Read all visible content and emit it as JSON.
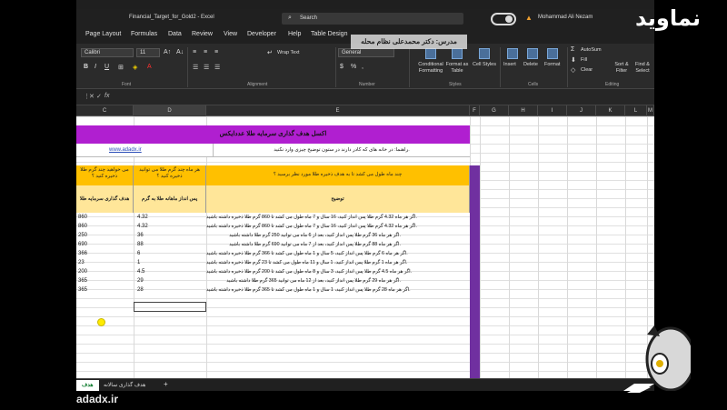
{
  "window": {
    "filename": "Financial_Target_for_Gold2 - Excel",
    "search_label": "Search",
    "user_name": "Mohammad Ali Nezam"
  },
  "menu": [
    "Page Layout",
    "Formulas",
    "Data",
    "Review",
    "View",
    "Developer",
    "Help",
    "Table Design"
  ],
  "ribbon": {
    "font_name": "Calibri",
    "font_size": "11",
    "wrap_text": "Wrap Text",
    "number_format": "General",
    "conditional_formatting": "Conditional Formatting",
    "format_as_table": "Format as Table",
    "cell_styles": "Cell Styles",
    "insert": "Insert",
    "delete": "Delete",
    "format": "Format",
    "autosum": "AutoSum",
    "fill": "Fill",
    "clear": "Clear",
    "sort_filter": "Sort & Filter",
    "find_select": "Find & Select",
    "groups": {
      "font": "Font",
      "alignment": "Alignment",
      "number": "Number",
      "styles": "Styles",
      "cells": "Cells",
      "editing": "Editing"
    }
  },
  "formula_bar": {
    "fx": "fx",
    "cancel": "✕",
    "confirm": "✓",
    "more": "⋮"
  },
  "columns": [
    "C",
    "D",
    "E",
    "F",
    "G",
    "H",
    "I",
    "J",
    "K",
    "L",
    "M"
  ],
  "sheet": {
    "banner": "اکسل هدف گذاری سرمایه طلا عددایکس",
    "link": "www.adadx.ir",
    "note": "راهنما: در خانه های که کادر دارند در ستون توضیح چیزی وارد نکنید.",
    "header_top": {
      "c": "می خواهید چند گرم طلا ذخیره کنید ؟",
      "d": "هر ماه چند گرم طلا می توانید ذخیره کنید ؟",
      "e": "چند ماه طول می کشد تا به هدف ذخیره طلا مورد نظر برسید ؟"
    },
    "header_bottom": {
      "c": "هدف گذاری سرمایه طلا",
      "d": "پس انداز ماهانه طلا به گرم",
      "e": "توضیح"
    },
    "rows": [
      {
        "target": "860",
        "monthly": "4.32",
        "desc": "اگر هر ماه 4.32 گرم طلا پس انداز کنید، 16 سال و 7 ماه طول می کشد تا 860 گرم طلا ذخیره داشته باشید."
      },
      {
        "target": "860",
        "monthly": "4.32",
        "desc": "اگر هر ماه 4.32 گرم طلا پس انداز کنید، 16 سال و 7 ماه طول می کشد تا 860 گرم طلا ذخیره داشته باشید."
      },
      {
        "target": "250",
        "monthly": "36",
        "desc": "اگر هر ماه 36 گرم طلا پس انداز کنید، بعد از 6 ماه می توانید 250 گرم طلا داشته باشید."
      },
      {
        "target": "690",
        "monthly": "88",
        "desc": "اگر هر ماه 88 گرم طلا پس انداز کنید، بعد از 7 ماه می توانید 690 گرم طلا داشته باشید."
      },
      {
        "target": "366",
        "monthly": "6",
        "desc": "اگر هر ماه 6 گرم طلا پس انداز کنید، 5 سال و 1 ماه طول می کشد تا 366 گرم طلا ذخیره داشته باشید."
      },
      {
        "target": "23",
        "monthly": "1",
        "desc": "اگر هر ماه 1 گرم طلا پس انداز کنید، 1 سال و 11 ماه طول می کشد تا 23 گرم طلا ذخیره داشته باشید."
      },
      {
        "target": "200",
        "monthly": "4.5",
        "desc": "اگر هر ماه 4.5 گرم طلا پس انداز کنید، 3 سال و 8 ماه طول می کشد تا 200 گرم طلا ذخیره داشته باشید."
      },
      {
        "target": "365",
        "monthly": "29",
        "desc": "اگر هر ماه 29 گرم طلا پس انداز کنید، بعد از 12 ماه می توانید 365 گرم طلا داشته باشید."
      },
      {
        "target": "365",
        "monthly": "28",
        "desc": "اگر هر ماه 28 گرم طلا پس انداز کنید، 1 سال و 1 ماه طول می کشد تا 365 گرم طلا ذخیره داشته باشید."
      }
    ]
  },
  "tabs": {
    "first": "هدف",
    "second": "هدف گذاری سالانه",
    "add": "+"
  },
  "overlay": {
    "teacher": "مدرس: دکتر محمدعلی نظام محله",
    "site_bottom": "adadx.ir",
    "logo": "نماوید"
  },
  "colors": {
    "banner": "#b01fd0",
    "header_top": "#ffc000",
    "header_bottom": "#ffe699",
    "frame": "#7030a0",
    "link": "#2b4db8"
  }
}
